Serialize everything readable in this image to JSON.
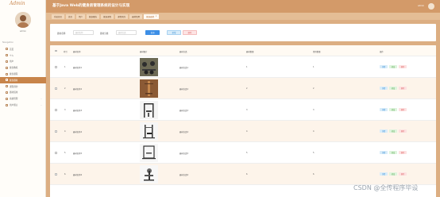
{
  "sidebar": {
    "logo": "Admin",
    "user_name": "admin",
    "nav_heading": "Navigation",
    "items": [
      {
        "label": "首页",
        "active": false,
        "has_chevron": false
      },
      {
        "label": "个人",
        "active": false,
        "has_chevron": false
      },
      {
        "label": "用户",
        "active": false,
        "has_chevron": false
      },
      {
        "label": "健身教练",
        "active": false,
        "has_chevron": false
      },
      {
        "label": "健身课程",
        "active": false,
        "has_chevron": false
      },
      {
        "label": "健身器材",
        "active": true,
        "has_chevron": false
      },
      {
        "label": "课程预约",
        "active": false,
        "has_chevron": false
      },
      {
        "label": "器材借用",
        "active": false,
        "has_chevron": false
      },
      {
        "label": "系统管理",
        "active": false,
        "has_chevron": true
      },
      {
        "label": "用户留言",
        "active": false,
        "has_chevron": true
      }
    ]
  },
  "header": {
    "title": "基于Java Web的健身房管理系统的设计与实现",
    "user": "admin"
  },
  "tabs": [
    {
      "label": "系统首页",
      "active": false
    },
    {
      "label": "首页",
      "active": false
    },
    {
      "label": "用户",
      "active": false
    },
    {
      "label": "健身教练",
      "active": false
    },
    {
      "label": "健身课程",
      "active": false
    },
    {
      "label": "课程预约",
      "active": false
    },
    {
      "label": "器材借用",
      "active": false
    },
    {
      "label": "健身器材",
      "active": true
    }
  ],
  "search": {
    "field1_label": "器材名称",
    "field1_placeholder": "器材名称",
    "field2_label": "器材分类",
    "field2_placeholder": "器材分类",
    "search_button": "查询",
    "add_button": "新增",
    "delete_button": "删除"
  },
  "table": {
    "headers": [
      "索引",
      "器材名称",
      "器材图片",
      "器材分类",
      "器材数量",
      "借用数量",
      "操作"
    ],
    "rows": [
      {
        "index": "1",
        "name": "器材名称1",
        "category": "器材分类1",
        "count": "1",
        "borrowed": "1"
      },
      {
        "index": "2",
        "name": "器材名称2",
        "category": "器材分类2",
        "count": "2",
        "borrowed": "2"
      },
      {
        "index": "3",
        "name": "器材名称3",
        "category": "器材分类3",
        "count": "3",
        "borrowed": "3"
      },
      {
        "index": "4",
        "name": "器材名称4",
        "category": "器材分类4",
        "count": "4",
        "borrowed": "4"
      },
      {
        "index": "5",
        "name": "器材名称5",
        "category": "器材分类5",
        "count": "5",
        "borrowed": "5"
      },
      {
        "index": "6",
        "name": "器材名称6",
        "category": "器材分类6",
        "count": "6",
        "borrowed": "6"
      }
    ],
    "ops": {
      "detail": "详情",
      "edit": "修改",
      "delete": "删除"
    }
  },
  "watermark": "CSDN @全传程序毕设"
}
